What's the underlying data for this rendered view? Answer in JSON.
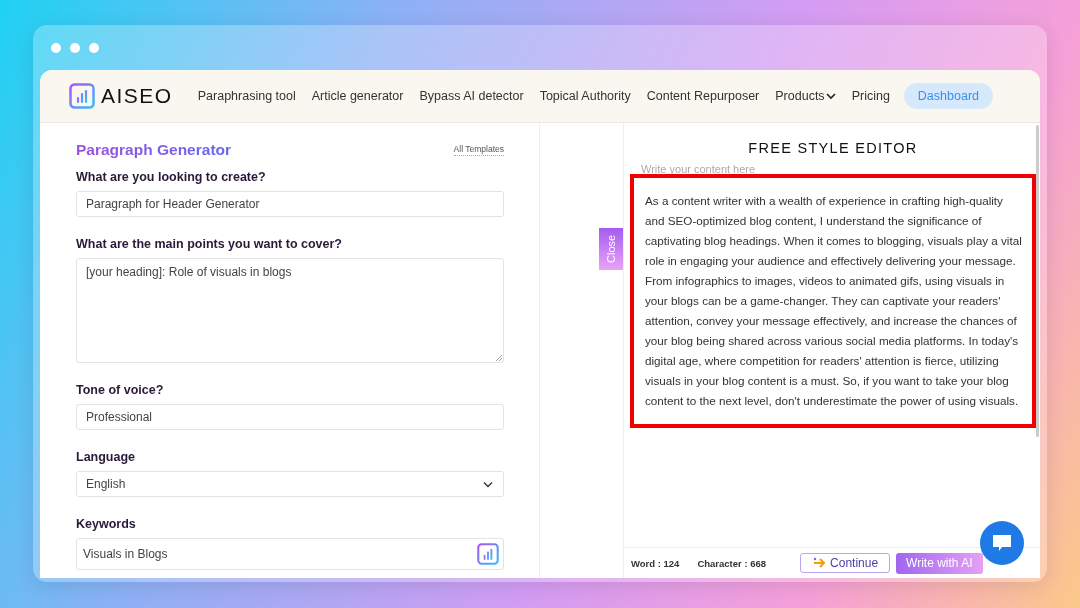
{
  "nav": {
    "logo": "AISEO",
    "links": [
      {
        "label": "Paraphrasing tool",
        "kind": "link"
      },
      {
        "label": "Article generator",
        "kind": "link"
      },
      {
        "label": "Bypass AI detector",
        "kind": "link"
      },
      {
        "label": "Topical Authority",
        "kind": "link"
      },
      {
        "label": "Content Repurposer",
        "kind": "link"
      },
      {
        "label": "Products",
        "kind": "dropdown"
      },
      {
        "label": "Pricing",
        "kind": "link"
      },
      {
        "label": "Dashboard",
        "kind": "button"
      }
    ]
  },
  "generator": {
    "title": "Paragraph Generator",
    "templates_link": "All Templates",
    "fields": [
      {
        "kind": "input",
        "label": "What are you looking to create?",
        "value": "Paragraph for Header Generator"
      },
      {
        "kind": "textarea",
        "label": "What are the main points you want to cover?",
        "value": "[your heading]: Role of visuals in blogs"
      },
      {
        "kind": "input",
        "label": "Tone of voice?",
        "value": "Professional"
      },
      {
        "kind": "select",
        "label": "Language",
        "value": "English"
      },
      {
        "kind": "keyword",
        "label": "Keywords",
        "value": "Visuals in Blogs"
      }
    ]
  },
  "close_tab": "Close",
  "editor": {
    "title": "FREE STYLE EDITOR",
    "placeholder": "Write your content here",
    "highlighted": true,
    "content_lines": [
      "As a content writer with a wealth of experience in crafting high-quality",
      "and SEO-optimized blog content, I understand the significance of",
      "captivating blog headings. When it comes to blogging, visuals play a vital",
      "role in engaging your audience and effectively delivering your message.",
      "From infographics to images, videos to animated gifs, using visuals in",
      "your blogs can be a game-changer. They can captivate your readers'",
      "attention, convey your message effectively, and increase the chances of",
      "your blog being shared across various social media platforms. In today's",
      "digital age, where competition for readers' attention is fierce, utilizing",
      "visuals in your blog content is a must. So, if you want to take your blog",
      "content to the next level, don't underestimate the power of using visuals."
    ],
    "word_count": "Word : 124",
    "char_count": "Character : 668",
    "continue_button": "Continue",
    "write_button": "Write with AI"
  }
}
